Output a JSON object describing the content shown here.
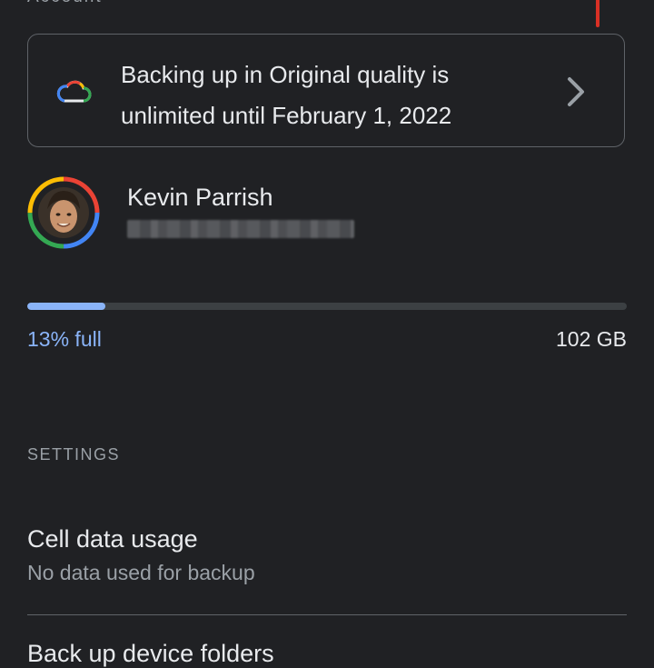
{
  "header": {
    "title_cut": "Account"
  },
  "notice": {
    "text": "Backing up in Original quality is unlimited until February 1, 2022",
    "icon": "cloud-icon",
    "action_icon": "chevron-right-icon"
  },
  "account": {
    "name": "Kevin Parrish",
    "avatar_icon": "avatar-photo"
  },
  "storage": {
    "percent_text": "13% full",
    "percent_value": 13,
    "total_text": "102 GB"
  },
  "settings": {
    "section_label": "SETTINGS",
    "items": [
      {
        "title": "Cell data usage",
        "subtitle": "No data used for backup"
      },
      {
        "title": "Back up device folders"
      }
    ]
  },
  "colors": {
    "background": "#202124",
    "accent": "#8ab4f8",
    "text_primary": "#e8eaed",
    "text_secondary": "#9aa0a6",
    "border": "#5f6368",
    "mark": "#d93025"
  }
}
